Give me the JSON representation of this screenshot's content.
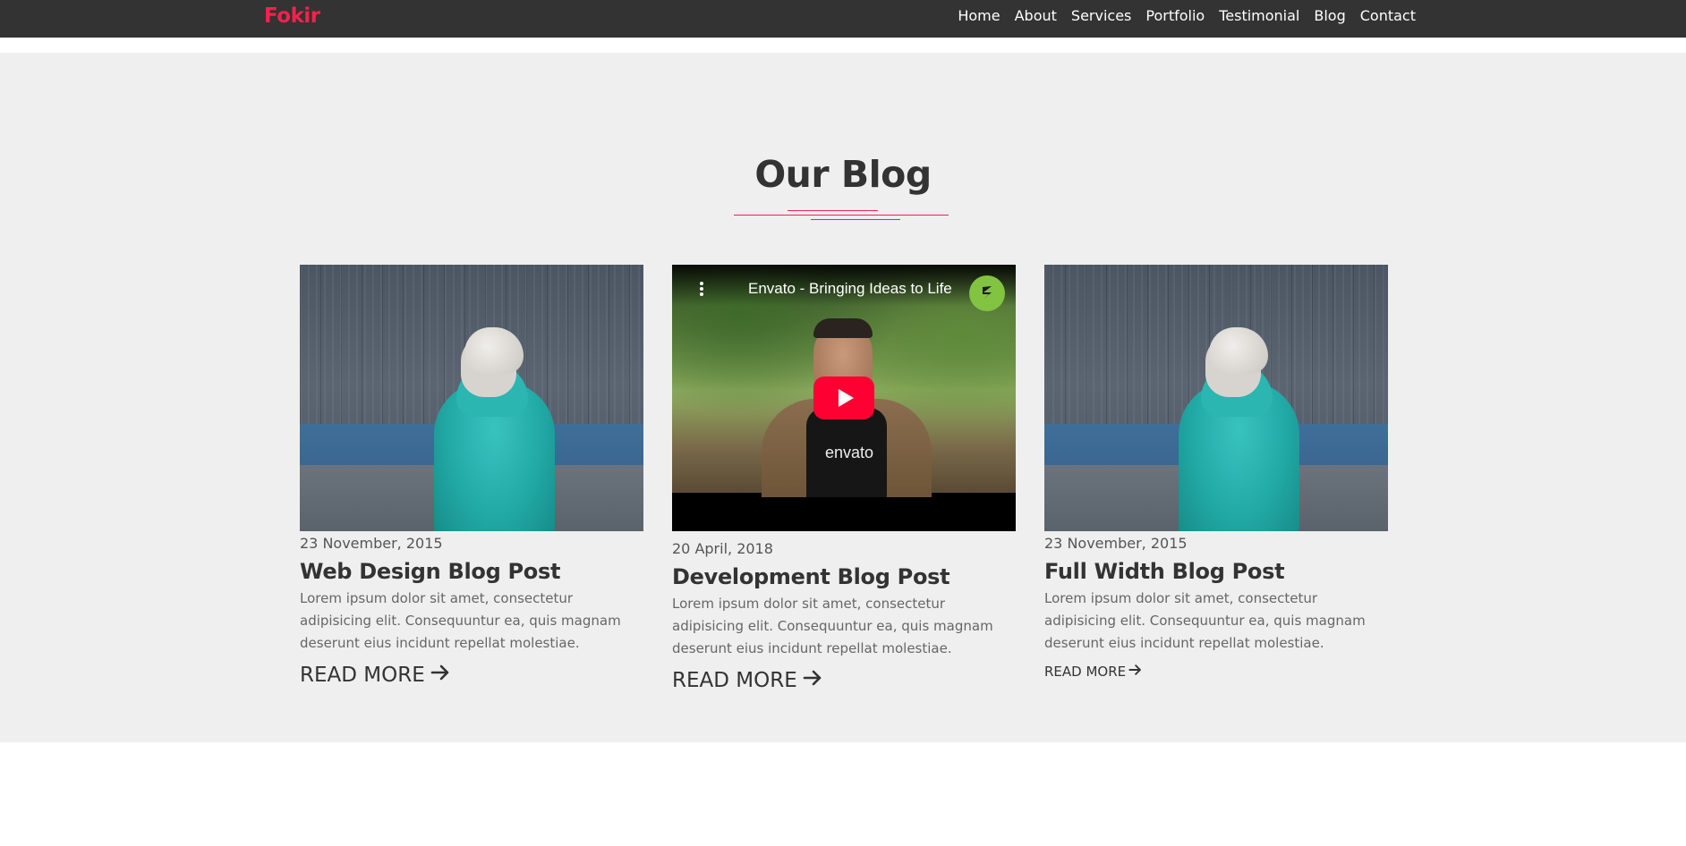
{
  "navbar": {
    "brand": "Fokir",
    "links": [
      "Home",
      "About",
      "Services",
      "Portfolio",
      "Testimonial",
      "Blog",
      "Contact"
    ]
  },
  "blog": {
    "title": "Our Blog",
    "cards": [
      {
        "media": "photo",
        "date": "23 November, 2015",
        "title": "Web Design Blog Post",
        "text": "Lorem ipsum dolor sit amet, consectetur adipisicing elit. Consequuntur ea, quis magnam deserunt eius incidunt repellat molestiae.",
        "read_more": "READ MORE"
      },
      {
        "media": "video",
        "video_title": "Envato - Bringing Ideas to Life",
        "video_shirt_text": "envato",
        "date": "20 April, 2018",
        "title": "Development Blog Post",
        "text": "Lorem ipsum dolor sit amet, consectetur adipisicing elit. Consequuntur ea, quis magnam deserunt eius incidunt repellat molestiae.",
        "read_more": "READ MORE"
      },
      {
        "media": "photo",
        "date": "23 November, 2015",
        "title": "Full Width Blog Post",
        "text": "Lorem ipsum dolor sit amet, consectetur adipisicing elit. Consequuntur ea, quis magnam deserunt eius incidunt repellat molestiae.",
        "read_more": "READ MORE"
      }
    ]
  },
  "colors": {
    "accent": "#f6214b",
    "navbar_bg": "#333333",
    "section_bg": "#efefef",
    "youtube_red": "#ff0033",
    "envato_green": "#82c341"
  },
  "icons": {
    "read_more_arrow": "arrow-right-icon",
    "video_play": "play-icon",
    "video_menu": "more-vertical-icon",
    "video_channel": "envato-logo-icon"
  }
}
